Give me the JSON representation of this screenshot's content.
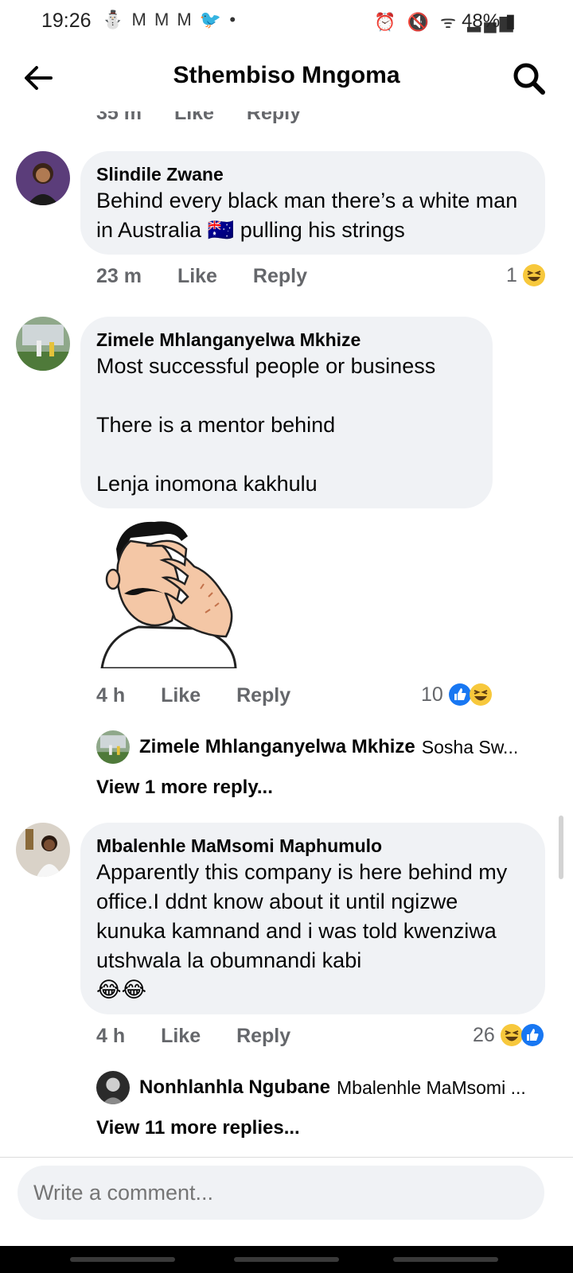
{
  "status": {
    "time": "19:26",
    "left_icons": "⛄ M M M 🐦 •",
    "right_icons": "⏰ 🔇 ᯤ ▂▄▆",
    "battery": "48%"
  },
  "header": {
    "title": "Sthembiso Mngoma"
  },
  "clipped_row": {
    "time": "35 m",
    "like": "Like",
    "reply": "Reply"
  },
  "comments": [
    {
      "author": "Slindile Zwane",
      "text": "Behind every black man there’s a white man in Australia 🇦🇺 pulling his strings",
      "time": "23 m",
      "like": "Like",
      "reply": "Reply",
      "reaction_count": "1"
    },
    {
      "author": "Zimele Mhlanganyelwa Mkhize",
      "text": "Most successful people or business\n\nThere is a mentor behind\n\nLenja inomona kakhulu",
      "time": "4 h",
      "like": "Like",
      "reply": "Reply",
      "reaction_count": "10",
      "reply_author": "Zimele Mhlanganyelwa Mkhize",
      "reply_preview": "Sosha Sw...",
      "more_replies": "View 1 more reply..."
    },
    {
      "author": "Mbalenhle MaMsomi Maphumulo",
      "text": "Apparently this company is here behind my office.I ddnt know about it until ngizwe kunuka kamnand and i was told kwenziwa utshwala la obumnandi kabi",
      "emoji_line": "😂😂",
      "time": "4 h",
      "like": "Like",
      "reply": "Reply",
      "reaction_count": "26",
      "reply_author": "Nonhlanhla Ngubane",
      "reply_preview": "Mbalenhle MaMsomi ...",
      "more_replies": "View 11 more replies..."
    }
  ],
  "composer": {
    "placeholder": "Write a comment..."
  },
  "colors": {
    "bubble": "#f0f2f5",
    "meta_gray": "#65676b",
    "like_blue": "#1877f2",
    "haha_yellow": "#f7c83c"
  },
  "icons": [
    "back-arrow-icon",
    "search-icon",
    "haha-reaction-icon",
    "like-reaction-icon",
    "facepalm-sticker"
  ]
}
